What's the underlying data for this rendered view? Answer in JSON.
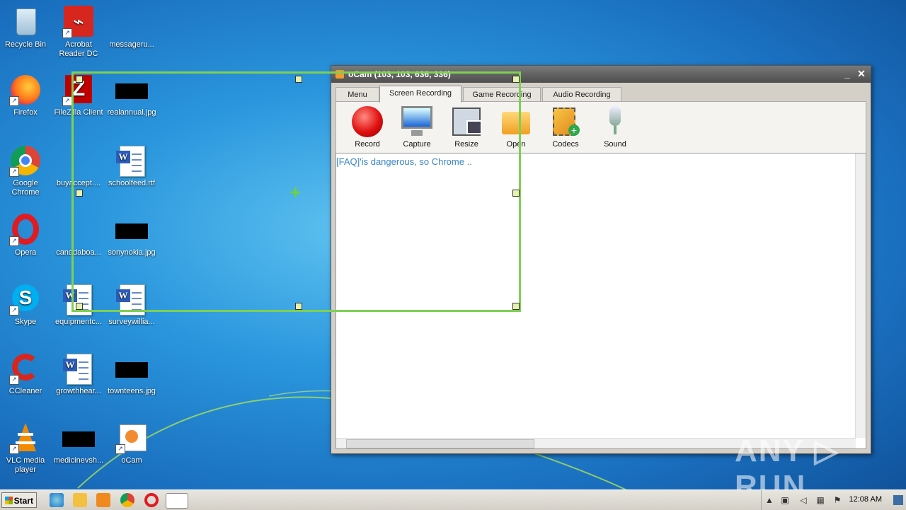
{
  "desktop": {
    "icons": [
      {
        "label": "Recycle Bin"
      },
      {
        "label": "Acrobat Reader DC"
      },
      {
        "label": "messageru..."
      },
      {
        "label": "Firefox"
      },
      {
        "label": "FileZilla Client"
      },
      {
        "label": "realannual.jpg"
      },
      {
        "label": "Google Chrome"
      },
      {
        "label": "buyaccept...."
      },
      {
        "label": "schoolfeed.rtf"
      },
      {
        "label": "Opera"
      },
      {
        "label": "canadaboa..."
      },
      {
        "label": "sonynokia.jpg"
      },
      {
        "label": "Skype"
      },
      {
        "label": "equipmentc..."
      },
      {
        "label": "surveywillia..."
      },
      {
        "label": "CCleaner"
      },
      {
        "label": "growthhear..."
      },
      {
        "label": "townteens.jpg"
      },
      {
        "label": "VLC media player"
      },
      {
        "label": "medicinevsh..."
      },
      {
        "label": "oCam"
      }
    ]
  },
  "ocam": {
    "title": "oCam (103, 103, 636, 336)",
    "tabs": [
      {
        "label": "Menu"
      },
      {
        "label": "Screen Recording"
      },
      {
        "label": "Game Recording"
      },
      {
        "label": "Audio Recording"
      }
    ],
    "tools": [
      {
        "label": "Record",
        "icon": "record-icon"
      },
      {
        "label": "Capture",
        "icon": "monitor-icon"
      },
      {
        "label": "Resize",
        "icon": "resize-icon"
      },
      {
        "label": "Open",
        "icon": "folder-icon"
      },
      {
        "label": "Codecs",
        "icon": "codecs-icon"
      },
      {
        "label": "Sound",
        "icon": "microphone-icon"
      }
    ],
    "content_text": "[FAQ]'is dangerous, so Chrome ..",
    "minimize": "_",
    "close": "✕"
  },
  "taskbar": {
    "start_label": "Start",
    "time": "12:08 AM"
  },
  "watermark": "ANY ▷ RUN",
  "colors": {
    "selection_border": "#7fcf55",
    "accent_text": "#3a86c8"
  }
}
